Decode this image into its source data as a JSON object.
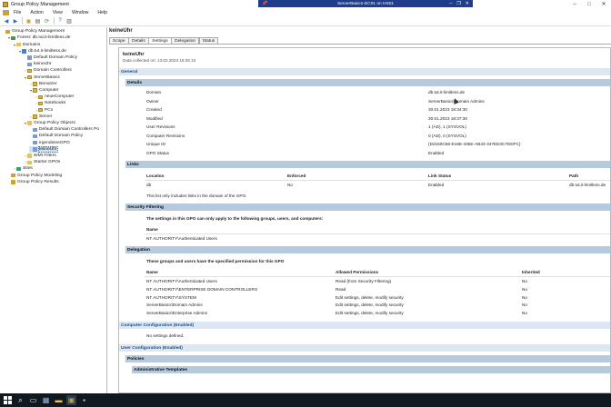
{
  "window": {
    "title": "Group Policy Management",
    "controls": [
      "–",
      "□",
      "✕"
    ]
  },
  "rdp_bar": {
    "title": "ServerBasics-DC01 on HS01",
    "left_icon": "pin-icon",
    "controls": [
      "–",
      "❐",
      "✕"
    ]
  },
  "menu": {
    "items": [
      "File",
      "Action",
      "View",
      "Window",
      "Help"
    ]
  },
  "toolbar": {
    "buttons": [
      "back-icon",
      "forward-icon",
      "up-icon",
      "show-hide-tree-icon",
      "refresh-icon",
      "help-icon",
      "properties-icon"
    ]
  },
  "tree": {
    "items": [
      {
        "label": "Group Policy Management",
        "icon": "gpm",
        "level": 0,
        "expander": ""
      },
      {
        "label": "Forest: db.tut.it-limitless.de",
        "icon": "forest",
        "level": 1,
        "expander": "▾"
      },
      {
        "label": "Domains",
        "icon": "folder",
        "level": 2,
        "expander": "▾"
      },
      {
        "label": "db.tut.it-limitless.de",
        "icon": "domain",
        "level": 3,
        "expander": "▾"
      },
      {
        "label": "Default Domain Policy",
        "icon": "gpo",
        "level": 4,
        "expander": ""
      },
      {
        "label": "keineUhr",
        "icon": "gpo",
        "level": 4,
        "expander": ""
      },
      {
        "label": "Domain Controllers",
        "icon": "ou",
        "level": 4,
        "expander": "›"
      },
      {
        "label": "ServerBasics",
        "icon": "ou",
        "level": 4,
        "expander": "▾"
      },
      {
        "label": "Benutzer",
        "icon": "ou",
        "level": 5,
        "expander": "›"
      },
      {
        "label": "Computer",
        "icon": "ou",
        "level": 5,
        "expander": "▾"
      },
      {
        "label": "neueComputer",
        "icon": "ou",
        "level": 6,
        "expander": "›"
      },
      {
        "label": "Notebooks",
        "icon": "ou",
        "level": 6,
        "expander": "›"
      },
      {
        "label": "PCs",
        "icon": "ou",
        "level": 6,
        "expander": "›"
      },
      {
        "label": "Server",
        "icon": "ou",
        "level": 5,
        "expander": "›"
      },
      {
        "label": "Group Policy Objects",
        "icon": "folder",
        "level": 4,
        "expander": "▾"
      },
      {
        "label": "Default Domain Controllers Po",
        "icon": "gpo",
        "level": 5,
        "expander": ""
      },
      {
        "label": "Default Domain Policy",
        "icon": "gpo",
        "level": 5,
        "expander": ""
      },
      {
        "label": "irgendeineGPO",
        "icon": "gpo",
        "level": 5,
        "expander": ""
      },
      {
        "label": "keineUhr",
        "icon": "gpo",
        "level": 5,
        "expander": "",
        "selected": true
      },
      {
        "label": "WMI Filters",
        "icon": "folder",
        "level": 4,
        "expander": "›"
      },
      {
        "label": "Starter GPOs",
        "icon": "folder",
        "level": 4,
        "expander": "›"
      },
      {
        "label": "Sites",
        "icon": "site",
        "level": 2,
        "expander": "›"
      },
      {
        "label": "Group Policy Modeling",
        "icon": "gpm",
        "level": 1,
        "expander": ""
      },
      {
        "label": "Group Policy Results",
        "icon": "gpm",
        "level": 1,
        "expander": ""
      }
    ]
  },
  "right": {
    "title": "keineUhr",
    "tabs": [
      "Scope",
      "Details",
      "Settings",
      "Delegation",
      "Status"
    ],
    "active_tab": "Settings"
  },
  "report": {
    "heading": "keineUhr",
    "collected": "Data collected on: 13.02.2023 15:25:13",
    "general": "General",
    "details": {
      "header": "Details",
      "rows": [
        {
          "k": "Domain",
          "v": "db.tut.it-limitless.de"
        },
        {
          "k": "Owner",
          "v": "ServerBasics\\Domain Admins"
        },
        {
          "k": "Created",
          "v": "30.01.2023 18:34:30"
        },
        {
          "k": "Modified",
          "v": "30.01.2023 18:37:30"
        },
        {
          "k": "User Revisions",
          "v": "1 (AD), 1 (SYSVOL)"
        },
        {
          "k": "Computer Revisions",
          "v": "0 (AD), 0 (SYSVOL)"
        },
        {
          "k": "Unique ID",
          "v": "{D2160C68-E18E-435E-AB43-347ED3C7DDFC}"
        },
        {
          "k": "GPO Status",
          "v": "Enabled"
        }
      ]
    },
    "links": {
      "header": "Links",
      "cols": [
        "Location",
        "Enforced",
        "Link Status",
        "Path"
      ],
      "row": [
        "db",
        "No",
        "Enabled",
        "db.tut.it-limitless.de"
      ],
      "note": "This list only includes links in the domain of the GPO."
    },
    "security": {
      "header": "Security Filtering",
      "intro": "The settings in this GPO can only apply to the following groups, users, and computers:",
      "col": "Name",
      "row": "NT AUTHORITY\\Authenticated Users"
    },
    "delegation": {
      "header": "Delegation",
      "intro": "These groups and users have the specified permission for this GPO",
      "cols": [
        "Name",
        "Allowed Permissions",
        "Inherited"
      ],
      "rows": [
        [
          "NT AUTHORITY\\Authenticated Users",
          "Read (from Security Filtering)",
          "No"
        ],
        [
          "NT AUTHORITY\\ENTERPRISE DOMAIN CONTROLLERS",
          "Read",
          "No"
        ],
        [
          "NT AUTHORITY\\SYSTEM",
          "Edit settings, delete, modify security",
          "No"
        ],
        [
          "ServerBasics\\Domain Admins",
          "Edit settings, delete, modify security",
          "No"
        ],
        [
          "ServerBasics\\Enterprise Admins",
          "Edit settings, delete, modify security",
          "No"
        ]
      ]
    },
    "computer_config": {
      "header": "Computer Configuration (Enabled)",
      "note": "No settings defined."
    },
    "user_config": {
      "header": "User Configuration (Enabled)"
    },
    "policies": "Policies",
    "admin_templates": "Administrative Templates"
  },
  "taskbar": {
    "items": [
      "start",
      "search-icon",
      "task-view-icon",
      "server-manager-icon",
      "file-explorer-icon",
      "gpm-icon",
      "cmd-icon"
    ]
  }
}
